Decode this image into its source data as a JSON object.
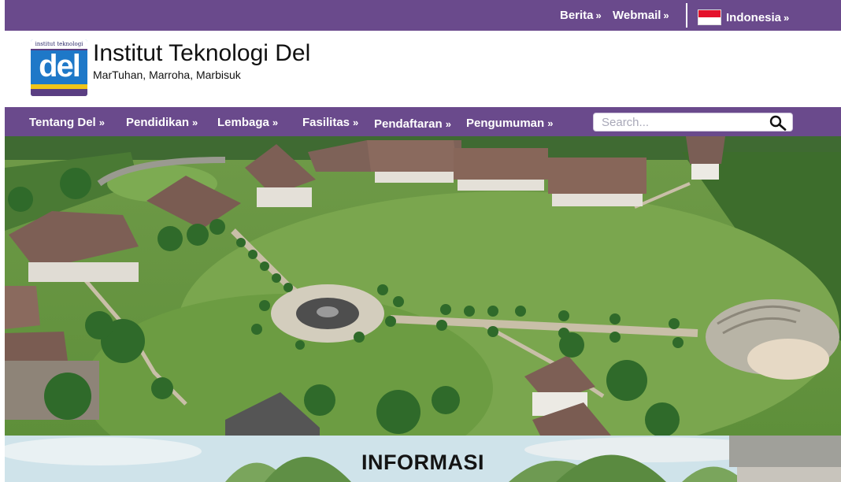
{
  "topbar": {
    "links": [
      {
        "label": "Berita",
        "chevron": "»"
      },
      {
        "label": "Webmail",
        "chevron": "»"
      }
    ],
    "language": {
      "label": "Indonesia",
      "chevron": "»",
      "flag_colors": [
        "#e4112b",
        "#ffffff"
      ]
    }
  },
  "header": {
    "logo_text": "del",
    "logo_band_text": "institut teknologi",
    "title": "Institut Teknologi Del",
    "tagline": "MarTuhan, Marroha, Marbisuk"
  },
  "nav": {
    "items": [
      {
        "label": "Tentang Del",
        "chevron": "»"
      },
      {
        "label": "Pendidikan",
        "chevron": "»"
      },
      {
        "label": "Lembaga",
        "chevron": "»"
      },
      {
        "label": "Fasilitas",
        "chevron": "»"
      },
      {
        "label": "Pendaftaran",
        "chevron": "»"
      },
      {
        "label": "Pengumuman",
        "chevron": "»"
      }
    ],
    "search": {
      "placeholder": "Search...",
      "icon": "search-icon"
    }
  },
  "info": {
    "heading": "INFORMASI"
  },
  "colors": {
    "brand_purple": "#6a4a8c",
    "white": "#ffffff"
  }
}
